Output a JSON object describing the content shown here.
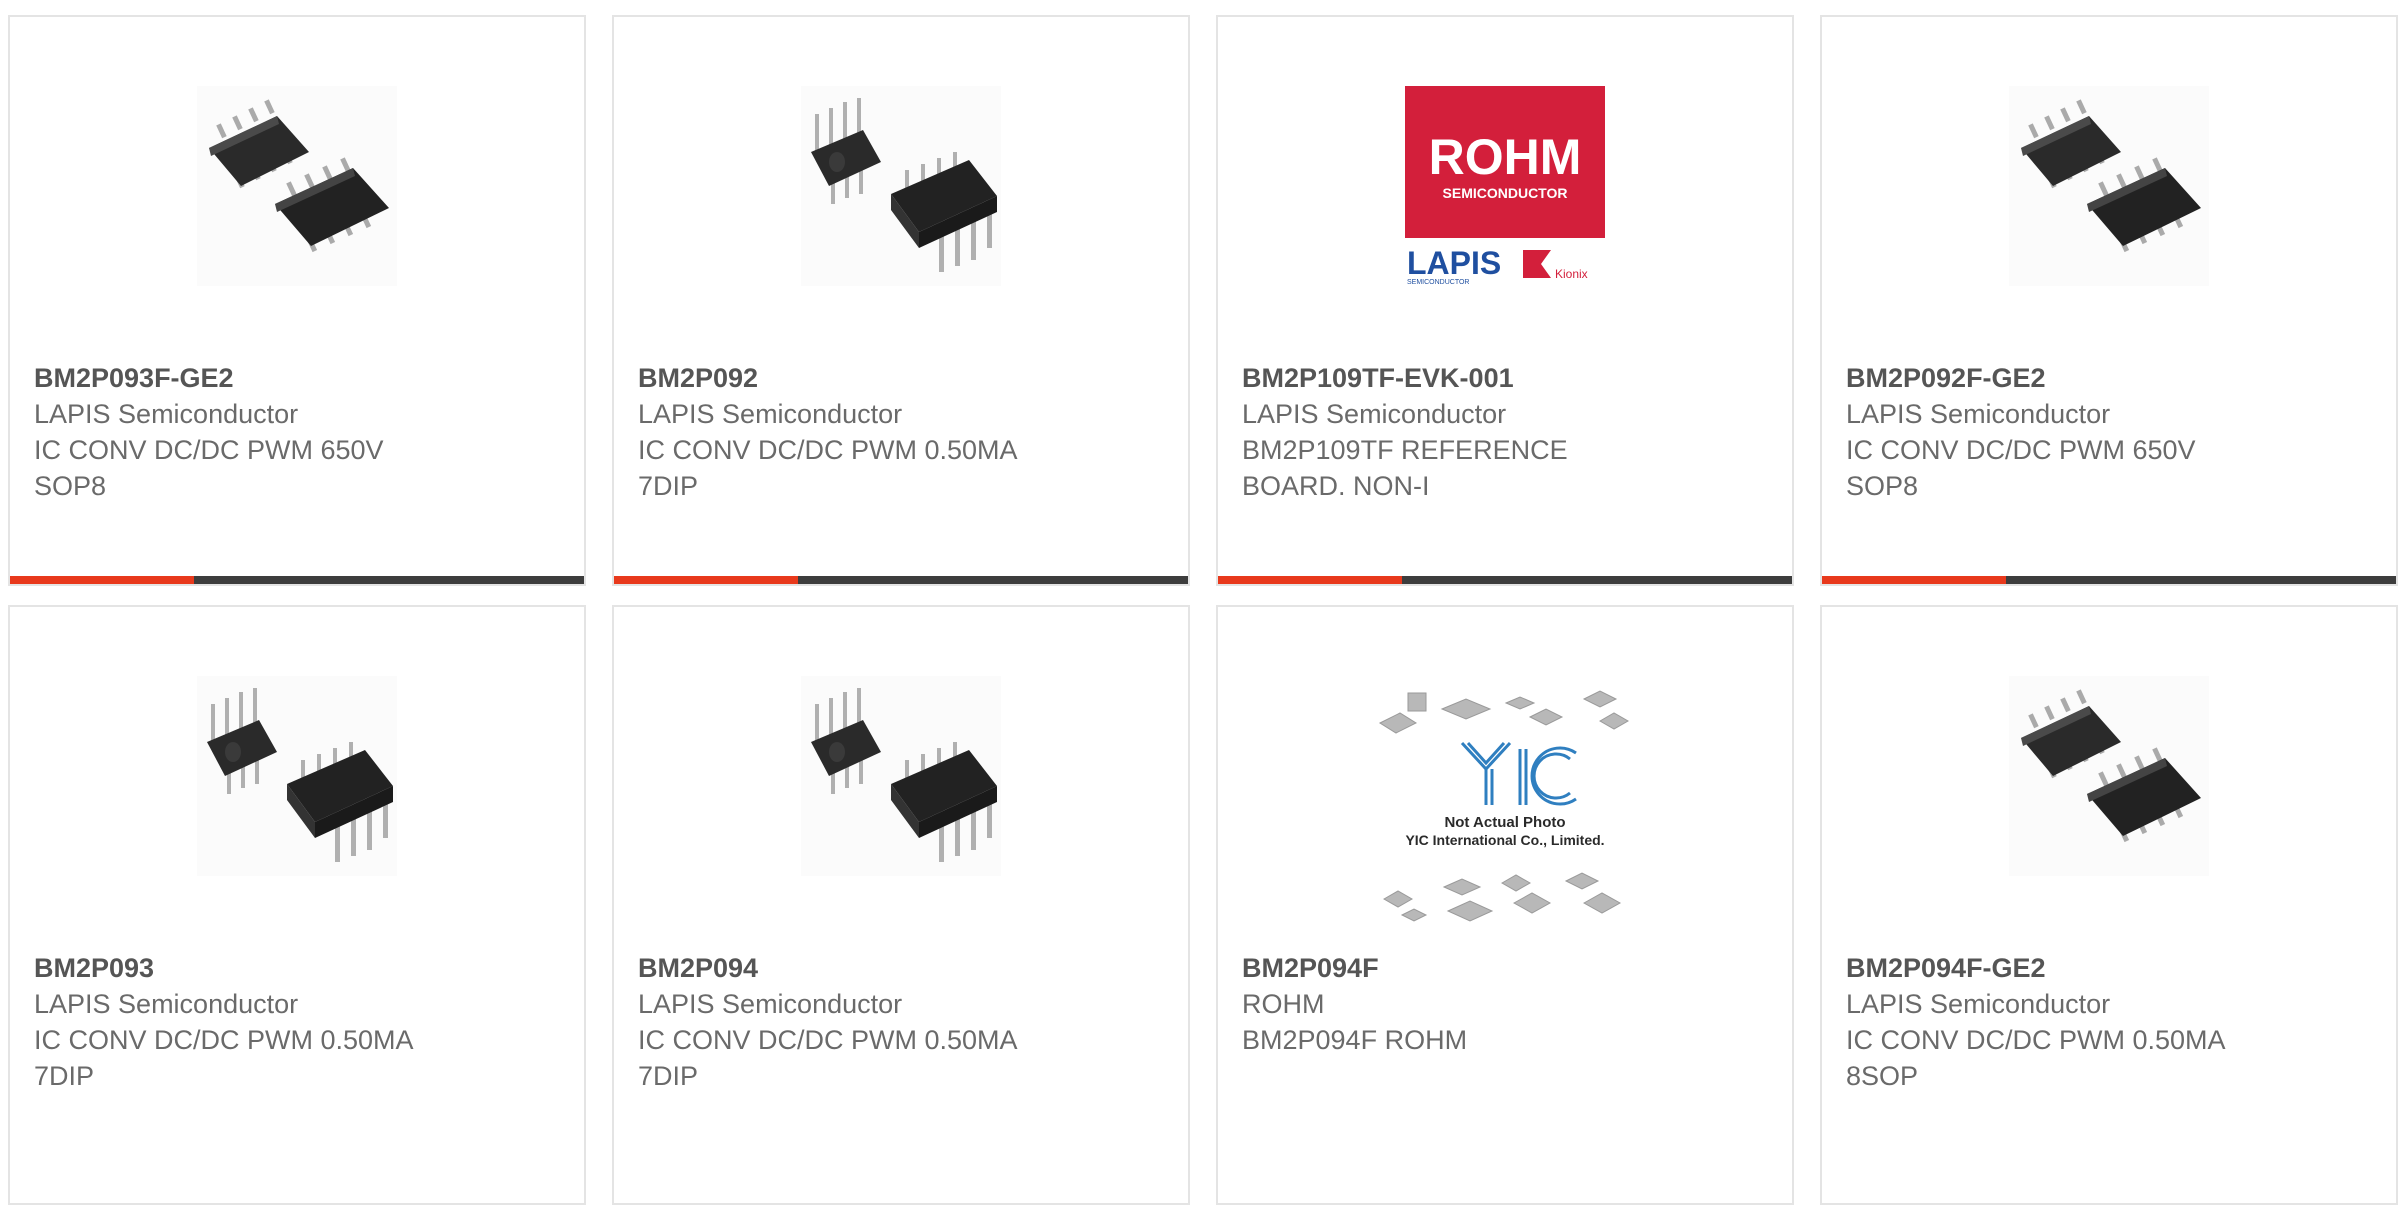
{
  "theme": {
    "accent": "#e8391c",
    "bar_track": "#3d3d3d",
    "card_border": "#e4e4e4",
    "text_title": "#555555",
    "text_body": "#6a6a6a"
  },
  "products": [
    {
      "part_number": "BM2P093F-GE2",
      "manufacturer": "LAPIS Semiconductor",
      "description_line1": "IC CONV DC/DC PWM 650V",
      "description_line2": "SOP8",
      "image": "sop8-chip-photo",
      "progress_fraction": 0.32
    },
    {
      "part_number": "BM2P092",
      "manufacturer": "LAPIS Semiconductor",
      "description_line1": "IC CONV DC/DC PWM 0.50MA",
      "description_line2": "7DIP",
      "image": "dip-chip-photo",
      "progress_fraction": 0.32
    },
    {
      "part_number": "BM2P109TF-EVK-001",
      "manufacturer": "LAPIS Semiconductor",
      "description_line1": "BM2P109TF REFERENCE",
      "description_line2": "BOARD. NON-I",
      "image": "rohm-lapis-kionix-logo",
      "logo_text": {
        "rohm": "ROHM",
        "rohm_sub": "SEMICONDUCTOR",
        "lapis": "LAPIS",
        "lapis_sub": "SEMICONDUCTOR",
        "kionix": "Kionix"
      },
      "progress_fraction": 0.32
    },
    {
      "part_number": "BM2P092F-GE2",
      "manufacturer": "LAPIS Semiconductor",
      "description_line1": "IC CONV DC/DC PWM 650V",
      "description_line2": "SOP8",
      "image": "sop8-chip-photo",
      "progress_fraction": 0.32
    },
    {
      "part_number": "BM2P093",
      "manufacturer": "LAPIS Semiconductor",
      "description_line1": "IC CONV DC/DC PWM 0.50MA",
      "description_line2": "7DIP",
      "image": "dip-chip-photo"
    },
    {
      "part_number": "BM2P094",
      "manufacturer": "LAPIS Semiconductor",
      "description_line1": "IC CONV DC/DC PWM 0.50MA",
      "description_line2": "7DIP",
      "image": "dip-chip-photo"
    },
    {
      "part_number": "BM2P094F",
      "manufacturer": "ROHM",
      "description_line1": "BM2P094F ROHM",
      "description_line2": "",
      "image": "yic-placeholder-photo",
      "placeholder_text": {
        "line1": "Not Actual Photo",
        "line2": "YIC International Co., Limited."
      }
    },
    {
      "part_number": "BM2P094F-GE2",
      "manufacturer": "LAPIS Semiconductor",
      "description_line1": "IC CONV DC/DC PWM 0.50MA",
      "description_line2": "8SOP",
      "image": "sop8-chip-photo"
    }
  ]
}
